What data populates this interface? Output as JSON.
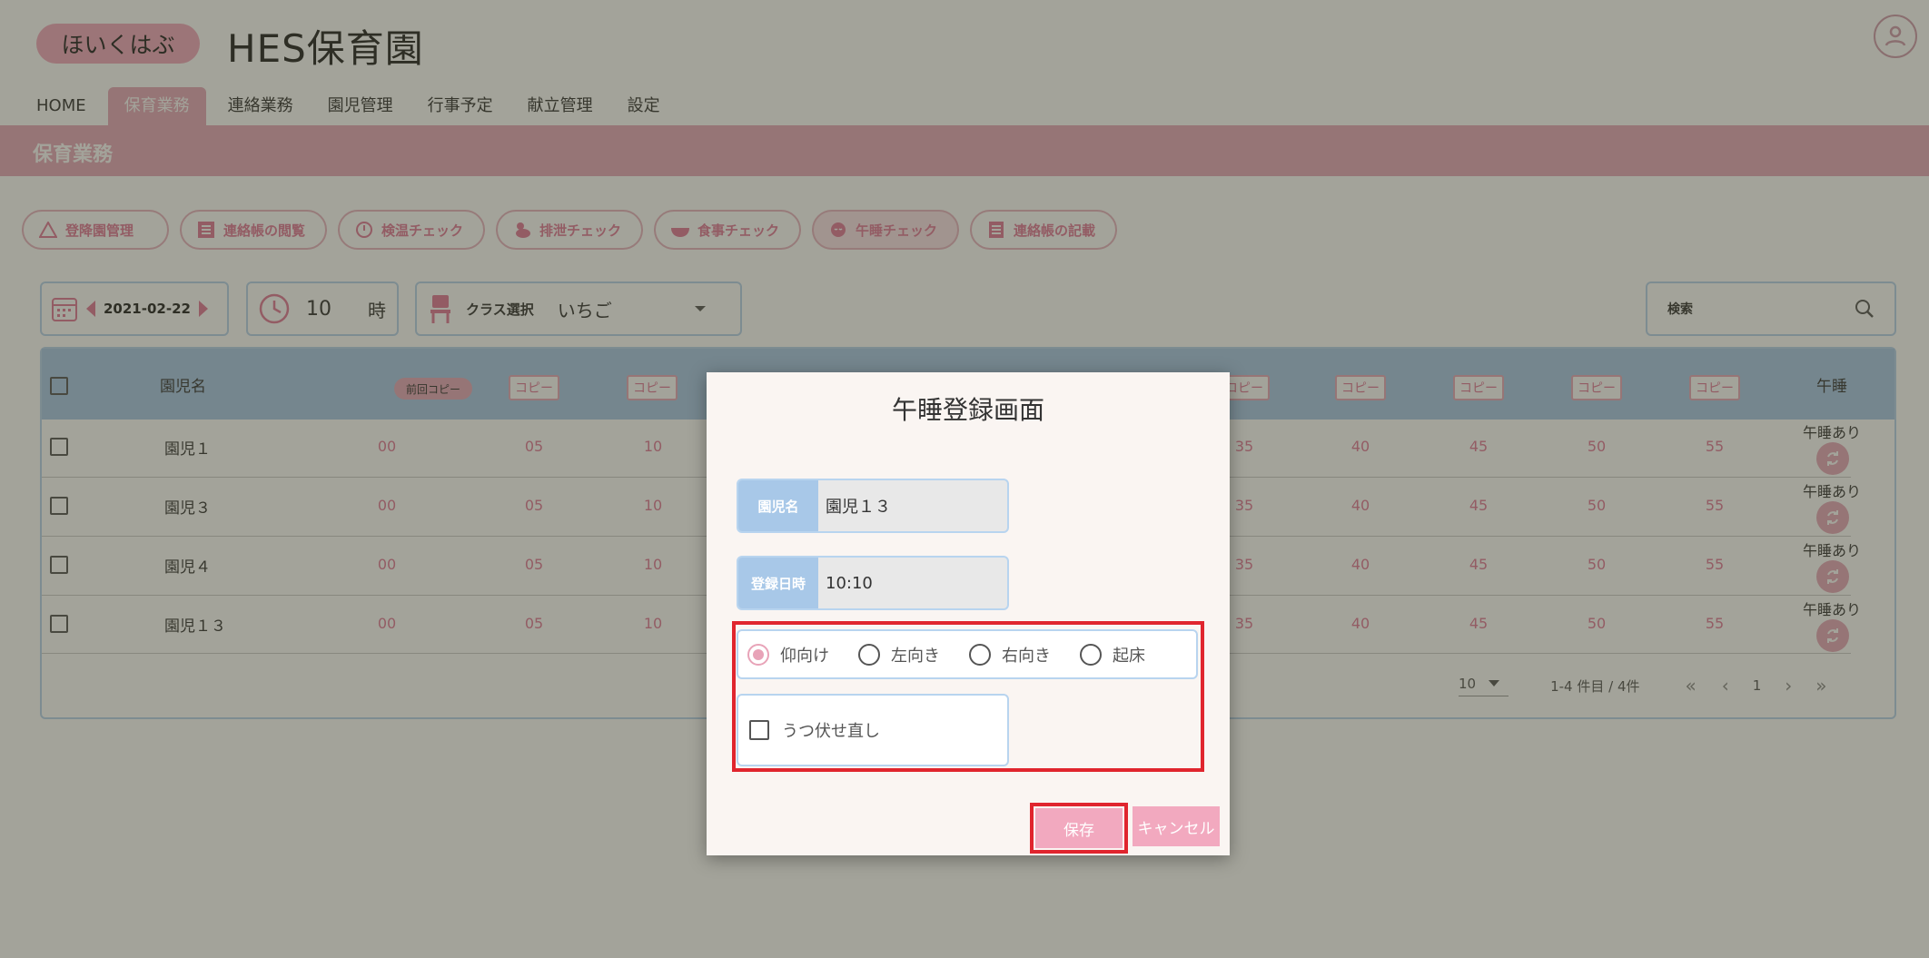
{
  "header": {
    "logo_text": "ほいくはぶ",
    "site_title": "HES保育園"
  },
  "nav": {
    "tabs": [
      "HOME",
      "保育業務",
      "連絡業務",
      "園児管理",
      "行事予定",
      "献立管理",
      "設定"
    ],
    "active": "保育業務"
  },
  "section_title": "保育業務",
  "function_buttons": [
    "登降園管理",
    "連絡帳の閲覧",
    "検温チェック",
    "排泄チェック",
    "食事チェック",
    "午睡チェック",
    "連絡帳の記載"
  ],
  "function_active": "午睡チェック",
  "controls": {
    "date": "2021-02-22",
    "hour": "10",
    "hour_unit": "時",
    "class_label": "クラス選択",
    "class_value": "いちご",
    "search_label": "検索"
  },
  "table": {
    "col_name": "園児名",
    "prev_copy": "前回コピー",
    "copy_label": "コピー",
    "col_nap": "午睡",
    "rows": [
      {
        "name": "園児１",
        "nap": "午睡あり"
      },
      {
        "name": "園児３",
        "nap": "午睡あり"
      },
      {
        "name": "園児４",
        "nap": "午睡あり"
      },
      {
        "name": "園児１３",
        "nap": "午睡あり"
      }
    ],
    "minutes": [
      "00",
      "05",
      "10",
      "35",
      "40",
      "45",
      "50",
      "55"
    ]
  },
  "pagination": {
    "per_page": "10",
    "range": "1-4 件目 / 4件",
    "page": "1"
  },
  "modal": {
    "title": "午睡登録画面",
    "name_label": "園児名",
    "name_value": "園児１３",
    "datetime_label": "登録日時",
    "datetime_value": "10:10",
    "positions": [
      "仰向け",
      "左向き",
      "右向き",
      "起床"
    ],
    "selected_position": "仰向け",
    "roll_label": "うつ伏せ直し",
    "save": "保存",
    "cancel": "キャンセル"
  },
  "colors": {
    "pink": "#e6a9bb",
    "blue": "#a8c8e8",
    "highlight": "#e0252e"
  }
}
